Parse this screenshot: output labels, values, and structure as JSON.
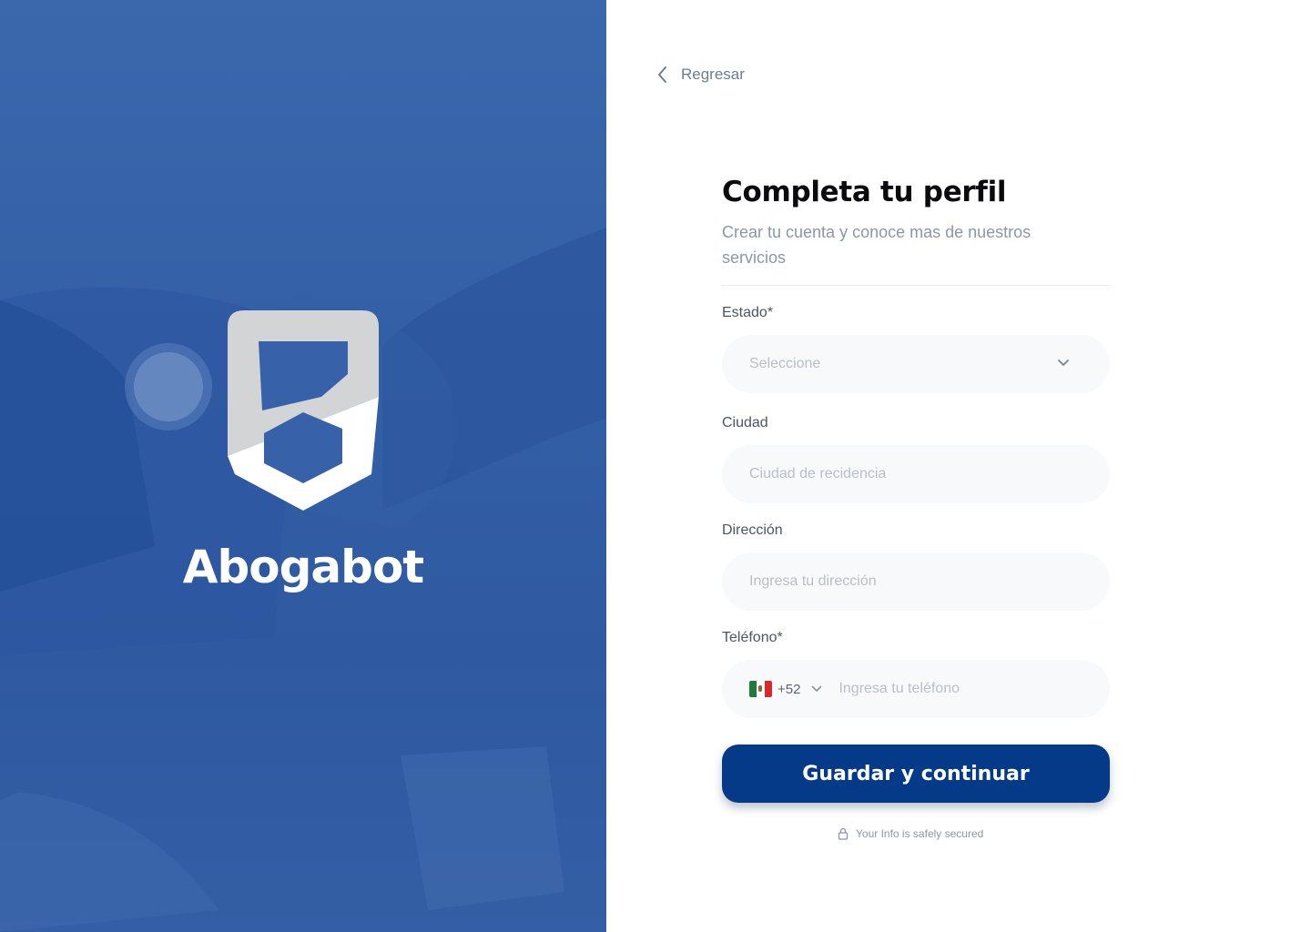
{
  "brand": {
    "name": "Abogabot"
  },
  "nav": {
    "back_label": "Regresar"
  },
  "form": {
    "title": "Completa tu perfil",
    "subtitle": "Crear tu cuenta y conoce mas de nuestros servicios",
    "estado": {
      "label": "Estado*",
      "placeholder": "Seleccione"
    },
    "ciudad": {
      "label": "Ciudad",
      "placeholder": "Ciudad de recidencia"
    },
    "direccion": {
      "label": "Dirección",
      "placeholder": "Ingresa tu dirección"
    },
    "telefono": {
      "label": "Teléfono*",
      "country_code": "+52",
      "placeholder": "Ingresa tu teléfono"
    },
    "submit_label": "Guardar y continuar",
    "secure_note": "Your Info is safely secured"
  },
  "colors": {
    "primary": "#053a88",
    "hero_blue": "#3762a9",
    "logo_gray": "#d3d4d6"
  },
  "icons": {
    "back": "chevron-left-icon",
    "dropdown": "chevron-down-icon",
    "lock": "lock-icon",
    "flag": "mexico-flag-icon"
  }
}
